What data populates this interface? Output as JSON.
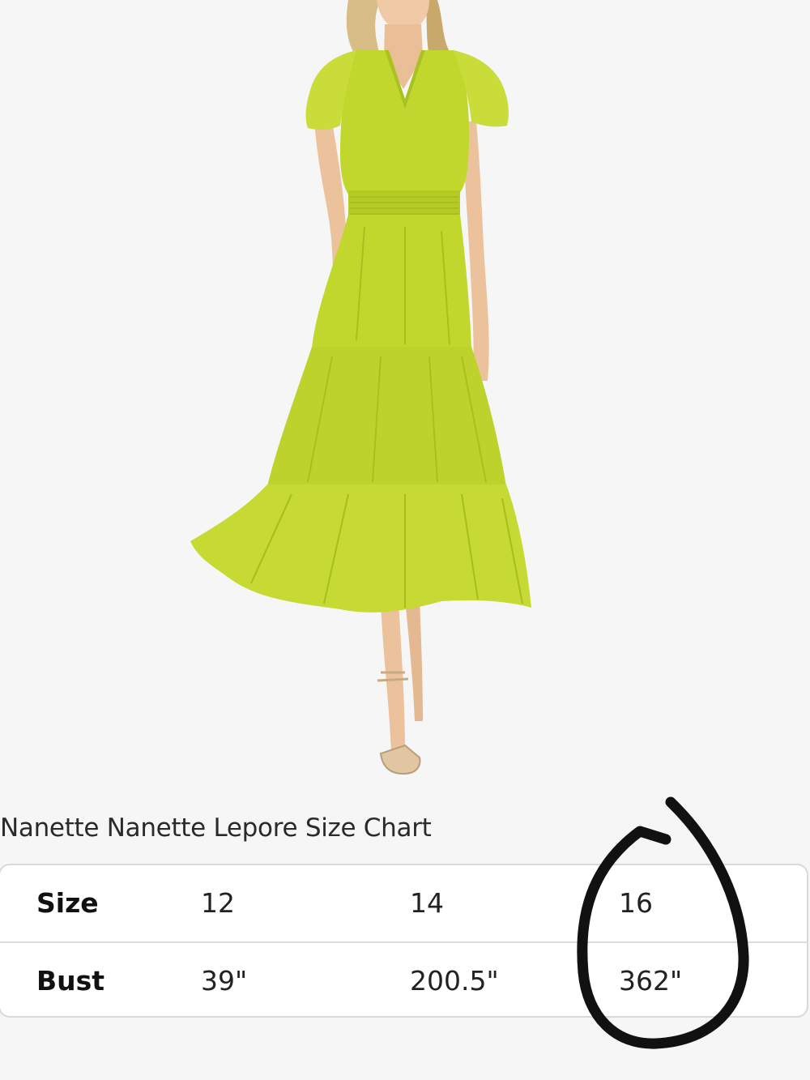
{
  "product": {
    "image_alt": "Model wearing a lime green tiered midi dress with flutter sleeves",
    "dress_color": "#c2d72e"
  },
  "size_chart": {
    "title": "Nanette Nanette Lepore Size Chart",
    "rows": [
      {
        "label": "Size",
        "values": [
          "12",
          "14",
          "16"
        ]
      },
      {
        "label": "Bust",
        "values": [
          "39\"",
          "200.5\"",
          "362\""
        ]
      }
    ]
  },
  "annotation": {
    "type": "hand-drawn circle",
    "color": "#111111",
    "target": "size 16 column"
  }
}
